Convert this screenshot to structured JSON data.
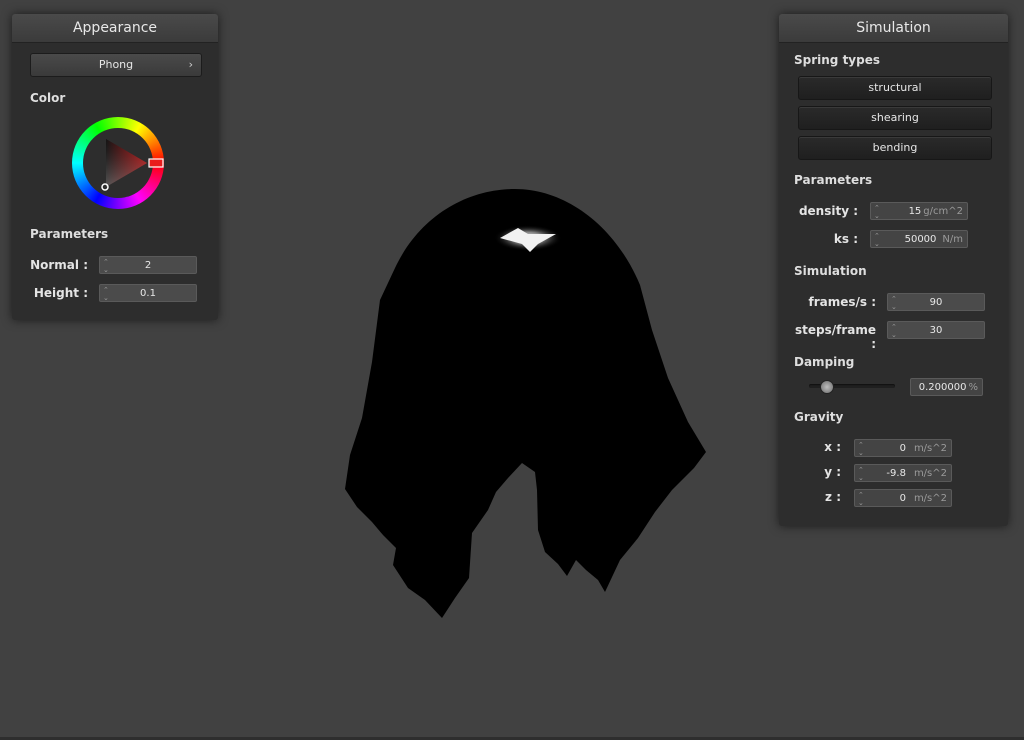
{
  "appearance": {
    "title": "Appearance",
    "shader": "Phong",
    "color_label": "Color",
    "color_hex": "#cc1f1f",
    "params_label": "Parameters",
    "normal_label": "Normal :",
    "normal_value": "2",
    "height_label": "Height :",
    "height_value": "0.1"
  },
  "simulation": {
    "title": "Simulation",
    "spring_types_label": "Spring types",
    "springs": [
      "structural",
      "shearing",
      "bending"
    ],
    "parameters_label": "Parameters",
    "density_label": "density :",
    "density_value": "15",
    "density_unit": "g/cm^2",
    "ks_label": "ks :",
    "ks_value": "50000",
    "ks_unit": "N/m",
    "simulation_label": "Simulation",
    "fps_label": "frames/s :",
    "fps_value": "90",
    "steps_label": "steps/frame :",
    "steps_value": "30",
    "damping_label": "Damping",
    "damping_fraction": 0.2,
    "damping_value": "0.200000",
    "damping_unit": "%",
    "gravity_label": "Gravity",
    "gx_label": "x :",
    "gx_value": "0",
    "gy_label": "y :",
    "gy_value": "-9.8",
    "gz_label": "z :",
    "gz_value": "0",
    "gravity_unit": "m/s^2"
  }
}
